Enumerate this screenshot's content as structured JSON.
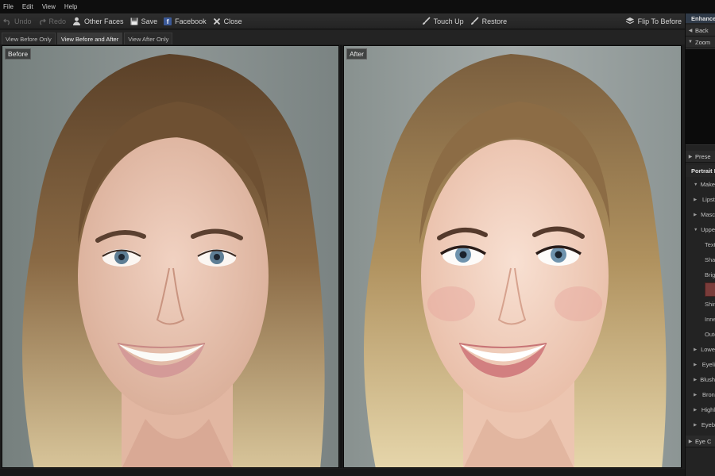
{
  "menu": [
    "File",
    "Edit",
    "View",
    "Help"
  ],
  "toolbar": {
    "undo": "Undo",
    "redo": "Redo",
    "other_faces": "Other Faces",
    "save": "Save",
    "facebook": "Facebook",
    "close": "Close",
    "touch_up": "Touch Up",
    "restore": "Restore",
    "flip": "Flip To Before"
  },
  "tabs": [
    "View Before Only",
    "View Before and After",
    "View After Only"
  ],
  "active_tab": "View Before and After",
  "panels": {
    "before_label": "Before",
    "after_label": "After"
  },
  "sidebar": {
    "header": "Enhance",
    "back": "Back",
    "zoom": "Zoom",
    "presets": "Prese",
    "portrait_header": "Portrait I",
    "makeup": "Make",
    "items_top": [
      "Lipst",
      "Masc",
      "Uppe"
    ],
    "sub_items_a": [
      "Textu",
      "Shap",
      "Brigh"
    ],
    "swatch_color": "#7a3c3a",
    "sub_items_b": [
      "Shini",
      "Inne",
      "Oute"
    ],
    "items_bottom": [
      "Lowe",
      "Eyeli",
      "Blush",
      "Bron",
      "Highl",
      "Eyeb"
    ],
    "eye": "Eye C"
  },
  "colors": {
    "facebook": "#3b5998",
    "sidebar_header": "#2f3a48"
  }
}
